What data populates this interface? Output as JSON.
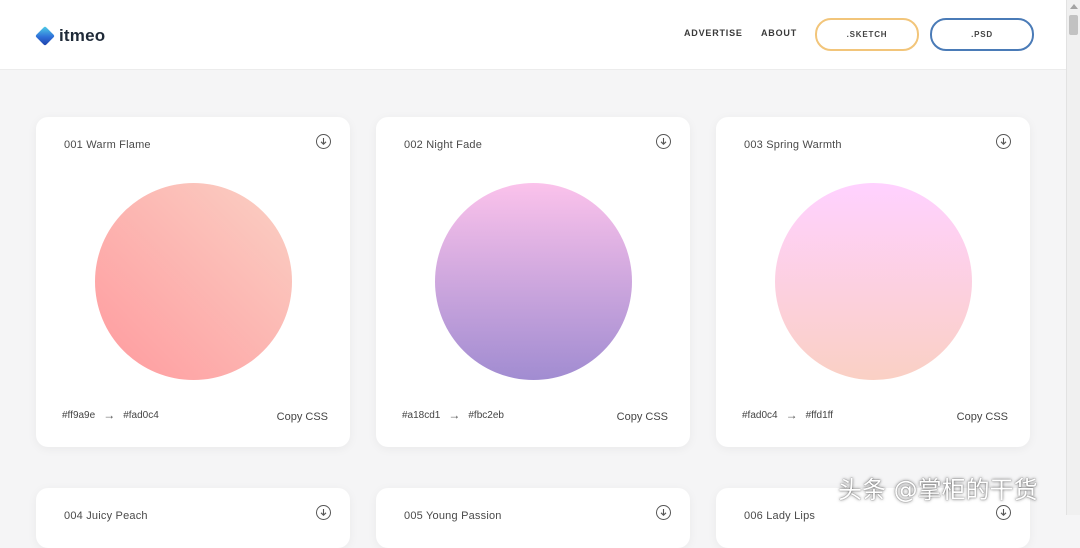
{
  "logo": {
    "text": "itmeo"
  },
  "nav": {
    "links": [
      "ADVERTISE",
      "ABOUT"
    ],
    "sketch_button": ".SKETCH",
    "psd_button": ".PSD"
  },
  "colors": {
    "sketch_border": "#f2c57a",
    "psd_border": "#4a7bb7",
    "background": "#f5f5f6"
  },
  "icons": {
    "download": "download-icon",
    "arrow": "arrow-right-icon"
  },
  "cards": [
    {
      "title": "001 Warm Flame",
      "color_from": "#ff9a9e",
      "color_to": "#fad0c4",
      "arrow": "→",
      "copy": "Copy CSS"
    },
    {
      "title": "002 Night Fade",
      "color_from": "#a18cd1",
      "color_to": "#fbc2eb",
      "arrow": "→",
      "copy": "Copy CSS"
    },
    {
      "title": "003 Spring Warmth",
      "color_from": "#fad0c4",
      "color_to": "#ffd1ff",
      "arrow": "→",
      "copy": "Copy CSS"
    },
    {
      "title": "004 Juicy Peach"
    },
    {
      "title": "005 Young Passion"
    },
    {
      "title": "006 Lady Lips"
    }
  ],
  "watermark": "头条 @掌柜的干货"
}
